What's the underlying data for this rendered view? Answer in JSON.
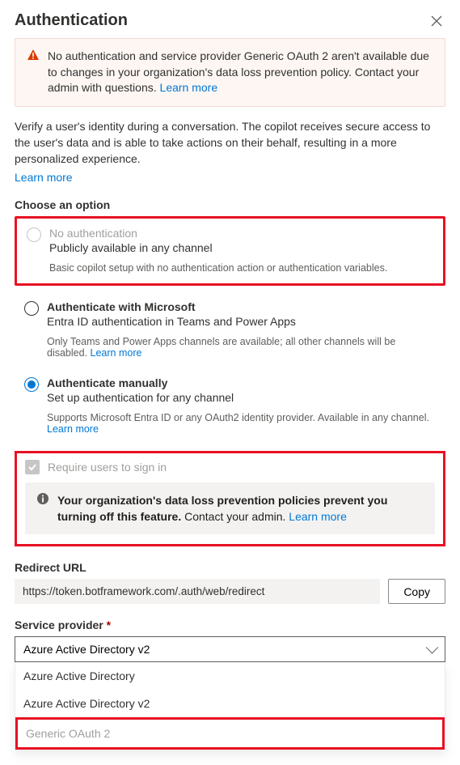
{
  "header": {
    "title": "Authentication"
  },
  "alert": {
    "text": "No authentication and service provider Generic OAuth 2 aren't available due to changes in your organization's data loss prevention policy. Contact your admin with questions.",
    "learn_more": "Learn more"
  },
  "intro": {
    "text": "Verify a user's identity during a conversation. The copilot receives secure access to the user's data and is able to take actions on their behalf, resulting in a more personalized experience.",
    "learn_more": "Learn more"
  },
  "choose_label": "Choose an option",
  "options": {
    "none": {
      "title": "No authentication",
      "sub": "Publicly available in any channel",
      "note": "Basic copilot setup with no authentication action or authentication variables."
    },
    "microsoft": {
      "title": "Authenticate with Microsoft",
      "sub": "Entra ID authentication in Teams and Power Apps",
      "note": "Only Teams and Power Apps channels are available; all other channels will be disabled.",
      "learn_more": "Learn more"
    },
    "manual": {
      "title": "Authenticate manually",
      "sub": "Set up authentication for any channel",
      "note": "Supports Microsoft Entra ID or any OAuth2 identity provider. Available in any channel.",
      "learn_more": "Learn more"
    }
  },
  "require_signin": {
    "label": "Require users to sign in",
    "banner_bold": "Your organization's data loss prevention policies prevent you turning off this feature.",
    "banner_rest": " Contact your admin.",
    "learn_more": "Learn more"
  },
  "redirect": {
    "label": "Redirect URL",
    "value": "https://token.botframework.com/.auth/web/redirect",
    "copy": "Copy"
  },
  "provider": {
    "label": "Service provider",
    "selected": "Azure Active Directory v2",
    "options": [
      "Azure Active Directory",
      "Azure Active Directory v2",
      "Generic OAuth 2"
    ]
  }
}
